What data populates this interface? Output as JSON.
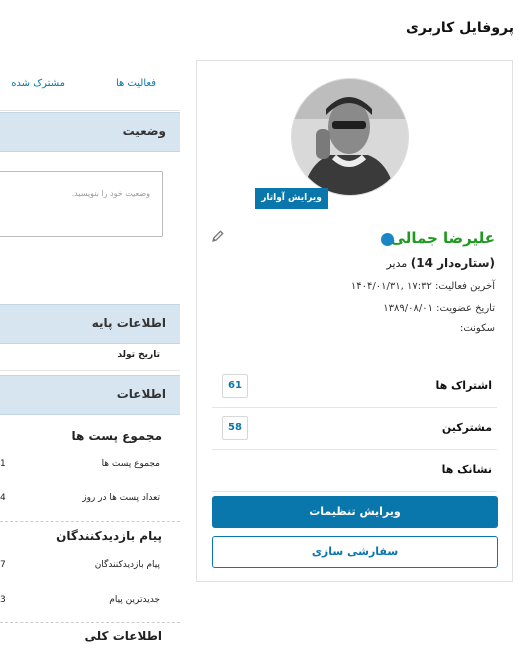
{
  "page_title": "پروفایل کاربری",
  "profile": {
    "edit_avatar": "ویرایش آواتار",
    "username": "علیرضا جمالی",
    "role": "مدیر",
    "rank": "(ستاره‌دار 14)",
    "last_activity": "آخرین فعالیت: ۱۷:۳۲ ,۱۴۰۴/۰۱/۳۱",
    "join_date": "تاریخ عضویت: ۱۳۸۹/۰۸/۰۱",
    "silence": "سکونت:",
    "stats": [
      {
        "label": "اشتراک ها",
        "value": "61"
      },
      {
        "label": "مشترکین",
        "value": "58"
      },
      {
        "label": "نشانک ها",
        "value": ""
      }
    ],
    "edit_settings": "ویرایش تنظیمات",
    "customize": "سفارشی سازی",
    "colors": {
      "accent": "#0a77ac",
      "username": "#1f9a1f",
      "online": "#1a86c3"
    }
  },
  "left": {
    "tabs": [
      "فعالیت ها",
      "مشترک شده"
    ],
    "status_head": "وضعیت",
    "status_placeholder": "وضعیت خود را بنویسید.",
    "basic_head": "اطلاعات پایه",
    "birthday": "تاریخ تولد",
    "info_head": "اطلاعات",
    "posts_head": "مجموع پست ها",
    "posts_total_label": "مجموع پست ها",
    "posts_total_value": "1",
    "posts_per_day_label": "تعداد پست ها در روز",
    "posts_per_day_value": "4",
    "visitor_head": "پیام بازدیدکنندگان",
    "visitor_label": "پیام بازدیدکنندگان",
    "visitor_value": "7",
    "latest_label": "جدیدترین پیام",
    "latest_value": "3",
    "general_head": "اطلاعات کلی"
  }
}
